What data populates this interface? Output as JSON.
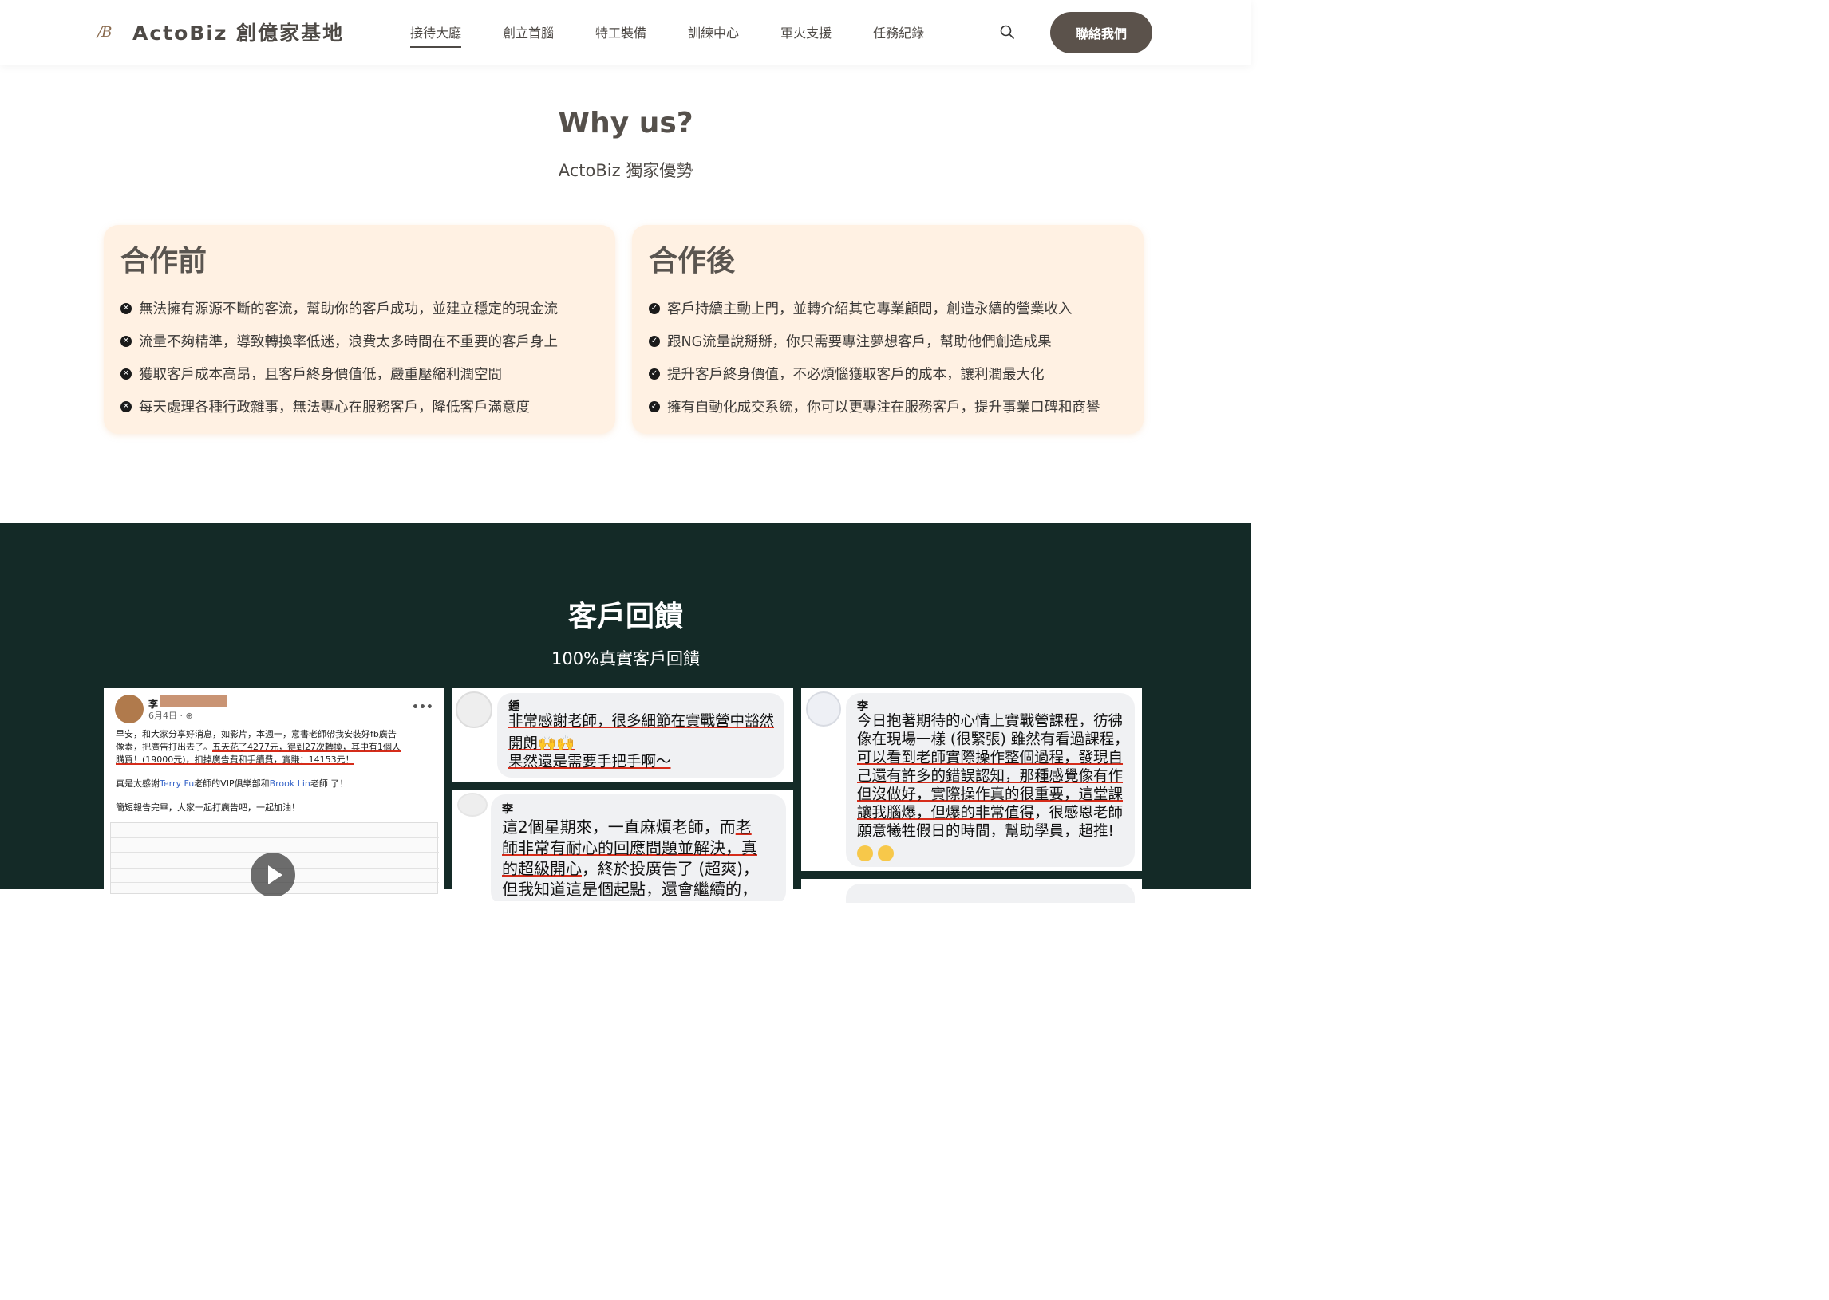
{
  "header": {
    "logo_mark": "/B",
    "logo_text": "ActoBiz 創億家基地",
    "nav": [
      "接待大廳",
      "創立首腦",
      "特工裝備",
      "訓練中心",
      "軍火支援",
      "任務紀錄"
    ],
    "active_nav": "接待大廳",
    "contact_label": "聯絡我們"
  },
  "why": {
    "title": "Why us?",
    "subtitle": "ActoBiz 獨家優勢",
    "before": {
      "title": "合作前",
      "items": [
        "無法擁有源源不斷的客流，幫助你的客戶成功，並建立穩定的現金流",
        "流量不夠精準，導致轉換率低迷，浪費太多時間在不重要的客戶身上",
        "獲取客戶成本高昂，且客戶終身價值低，嚴重壓縮利潤空間",
        "每天處理各種行政雜事，無法專心在服務客戶，降低客戶滿意度"
      ]
    },
    "after": {
      "title": "合作後",
      "items": [
        "客戶持續主動上門，並轉介紹其它專業顧問，創造永續的營業收入",
        "跟NG流量說掰掰，你只需要專注夢想客戶，幫助他們創造成果",
        "提升客戶終身價值，不必煩惱獲取客戶的成本，讓利潤最大化",
        "擁有自動化成交系統，你可以更專注在服務客戶，提升事業口碑和商譽"
      ]
    }
  },
  "feedback": {
    "title": "客戶回饋",
    "subtitle": "100%真實客戶回饋",
    "post": {
      "name": "李",
      "date": "6月4日 · ⊕",
      "line1": "早安，和大家分享好消息，如影片，本週一，意書老師帶我安裝好fb廣告",
      "line2a": "像素，把廣告打出去了。",
      "line2b": "五天花了4277元，得到27次轉換，其中有1個人",
      "line3": "購買！(19000元)，扣掉廣告費和手續費，實賺：14153元！",
      "line4a": "真是太感謝",
      "line4b": "Terry Fu",
      "line4c": "老師的VIP俱樂部和",
      "line4d": "Brook Lin",
      "line4e": "老師 了！",
      "line5": "簡短報告完畢，大家一起打廣告吧，一起加油！"
    },
    "comment1": {
      "name": "鍾",
      "line1": "非常感謝老師，很多細節在實戰營中豁然",
      "line2": "開朗🙌🙌",
      "line3": "果然還是需要手把手啊～"
    },
    "comment2": {
      "name": "李",
      "line1a": "這2個星期來，一直麻煩老師，而",
      "line1b": "老",
      "line2": "師非常有耐心的回應問題並解決，真",
      "line3a": "的超級開心",
      "line3b": "，終於投廣告了 (超爽)，",
      "line4": "但我知道這是個起點，還會繼續的，"
    },
    "comment3": {
      "name": "李",
      "line1": "今日抱著期待的心情上實戰營課程，彷彿",
      "line2": "像在現場一樣 (很緊張) 雖然有看過課程，",
      "line3": "可以看到老師實際操作整個過程，發現自",
      "line4": "己還有許多的錯誤認知，那種感覺像有作",
      "line5": "但沒做好，實際操作真的很重要，這堂課",
      "line6a": "讓我腦爆，但爆的非常值得",
      "line6b": "，很感恩老師",
      "line7": "願意犧牲假日的時間，幫助學員，超推!"
    }
  }
}
